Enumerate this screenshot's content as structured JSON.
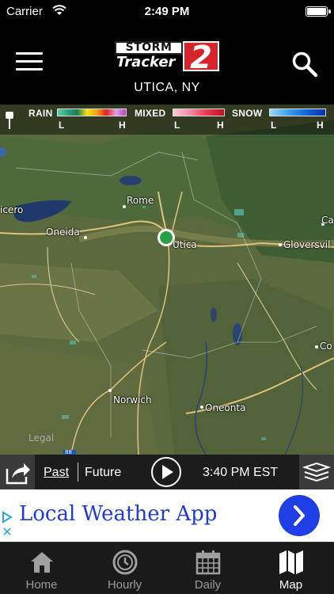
{
  "status_bar": {
    "carrier": "Carrier",
    "time": "2:49 PM"
  },
  "header": {
    "logo_storm": "STORM",
    "logo_tracker": "Tracker",
    "logo_number": "2",
    "location": "UTICA, NY"
  },
  "legend": {
    "rain": "RAIN",
    "mixed": "MIXED",
    "snow": "SNOW",
    "low": "L",
    "high": "H",
    "colors": {
      "rain": [
        "#5fd0a8",
        "#2fa37c",
        "#1e7a57",
        "#f2e21a",
        "#f2a41a",
        "#e52020",
        "#d8a3e8",
        "#c040c0"
      ],
      "mixed": [
        "#f7c9d3",
        "#f08aa5",
        "#e8394f",
        "#c01020"
      ],
      "snow": [
        "#9fd8f5",
        "#3ba0e8",
        "#1463d6",
        "#0a2fa8"
      ]
    }
  },
  "map": {
    "labels": {
      "rome": "Rome",
      "oneida": "Oneida",
      "utica": "Utica",
      "gloversville": "Gloversvil",
      "norwich": "Norwich",
      "oneonta": "Oneonta",
      "icero": "icero",
      "ca": "Ca",
      "co": "Co",
      "legal": "Legal",
      "shield": "88"
    }
  },
  "controls": {
    "past": "Past",
    "future": "Future",
    "timestamp": "3:40 PM EST"
  },
  "ad": {
    "text": "Local Weather App"
  },
  "tabs": [
    {
      "label": "Home",
      "icon": "home-icon"
    },
    {
      "label": "Hourly",
      "icon": "clock-icon"
    },
    {
      "label": "Daily",
      "icon": "calendar-icon"
    },
    {
      "label": "Map",
      "icon": "map-icon"
    }
  ],
  "active_tab": "Map"
}
